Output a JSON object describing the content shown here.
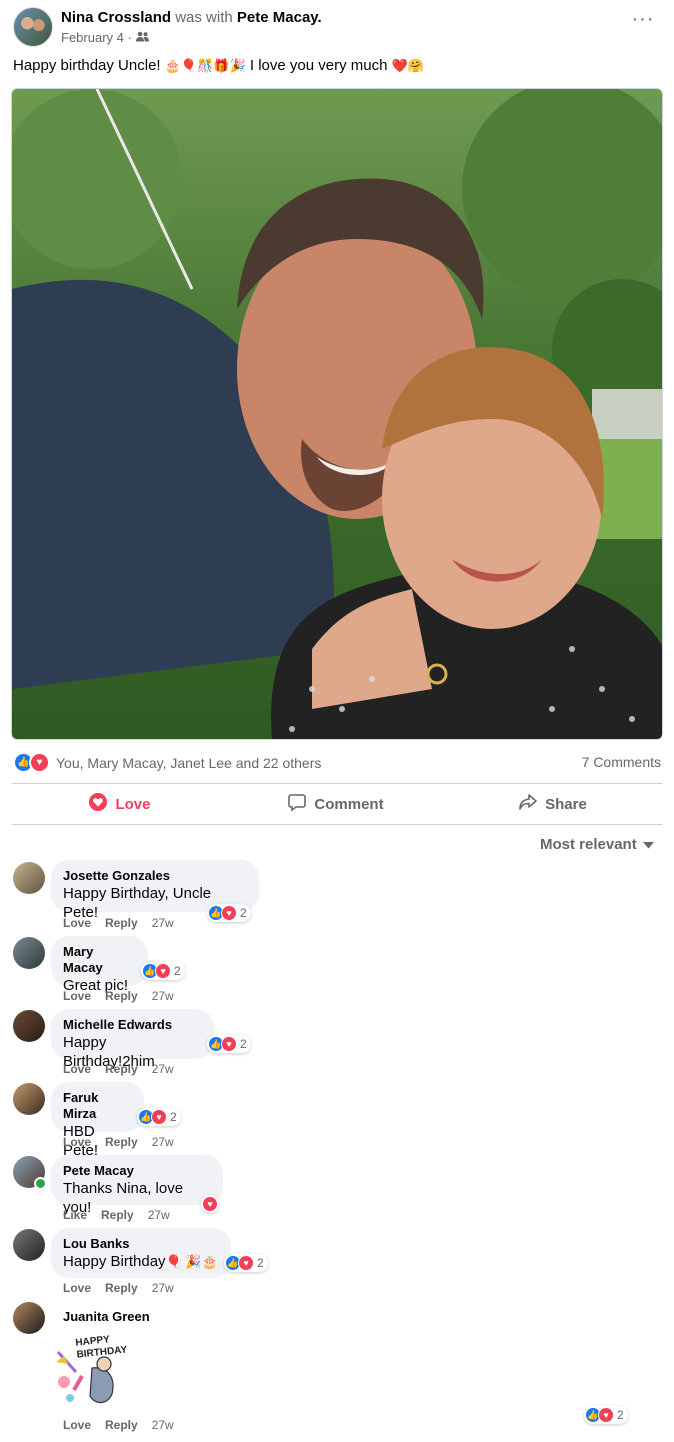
{
  "post": {
    "author": "Nina Crossland",
    "with_text": "was with",
    "tagged": "Pete Macay.",
    "date": "February 4 ·",
    "text": "Happy birthday Uncle!",
    "text_emojis": "🎂🎈🎊🎁🎉",
    "text_tail": "I love you very much",
    "text_tail_emojis": "❤️🤗",
    "more_label": "···"
  },
  "reactions": {
    "summary": "You, Mary Macay, Janet Lee and 22 others",
    "comments_count": "7 Comments"
  },
  "actions": {
    "love": "Love",
    "comment": "Comment",
    "share": "Share"
  },
  "sort_label": "Most relevant",
  "comments": [
    {
      "name": "Josette Gonzales",
      "text": "Happy Birthday, Uncle Pete!",
      "like": "Love",
      "reply": "Reply",
      "time": "27w",
      "count": "2"
    },
    {
      "name": "Mary Macay",
      "text": "Great pic!",
      "like": "Love",
      "reply": "Reply",
      "time": "27w",
      "count": "2"
    },
    {
      "name": "Michelle Edwards",
      "text": "Happy Birthday!2him",
      "like": "Love",
      "reply": "Reply",
      "time": "27w",
      "count": "2"
    },
    {
      "name": "Faruk Mirza",
      "text": "HBD Pete!",
      "like": "Love",
      "reply": "Reply",
      "time": "27w",
      "count": "2"
    },
    {
      "name": "Pete Macay",
      "text": "Thanks Nina, love you!",
      "like": "Like",
      "reply": "Reply",
      "time": "27w",
      "count": ""
    },
    {
      "name": "Lou Banks",
      "text": "Happy Birthday",
      "text_emojis": "🎈 🎉🎂",
      "like": "Love",
      "reply": "Reply",
      "time": "27w",
      "count": "2"
    },
    {
      "name": "Juanita Green",
      "sticker_text": "HAPPY BIRTHDAY",
      "like": "Love",
      "reply": "Reply",
      "time": "27w",
      "count": "2"
    }
  ],
  "colors": {
    "like_blue": "#1877f2",
    "love_red": "#f33e58",
    "muted": "#65676b",
    "bubble": "#f0f2f5"
  }
}
